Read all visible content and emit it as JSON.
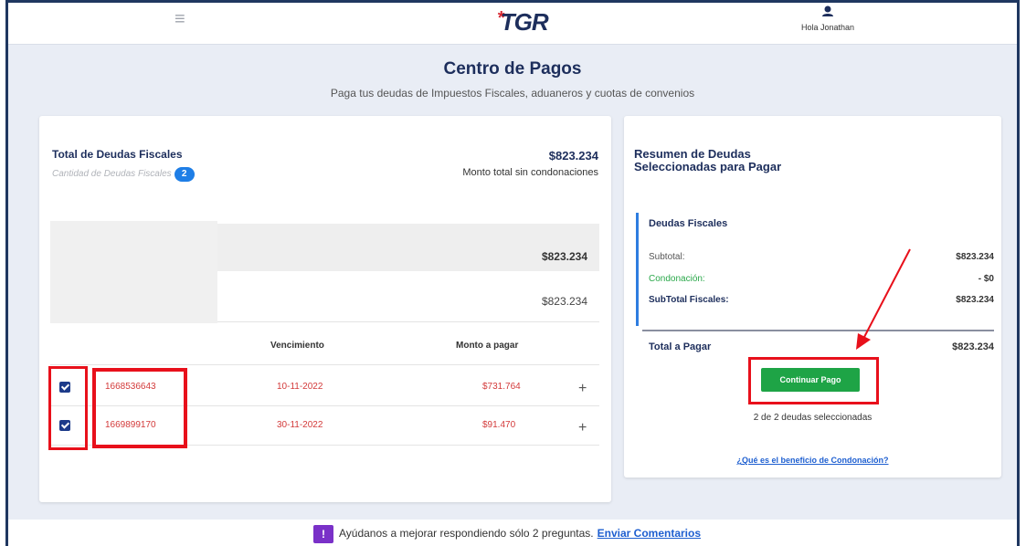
{
  "header": {
    "menu_icon": "hamburger-icon",
    "logo_star": "*",
    "logo_text": "TGR",
    "user_icon": "user-icon",
    "user_greeting": "Hola Jonathan"
  },
  "page": {
    "title": "Centro de Pagos",
    "subtitle": "Paga tus deudas de Impuestos Fiscales, aduaneros y cuotas de convenios"
  },
  "deudas": {
    "title": "Total de Deudas Fiscales",
    "count_label": "Cantidad de Deudas Fiscales",
    "count": "2",
    "total": "$823.234",
    "total_label": "Monto total sin condonaciones",
    "row_a_value": "$823.234",
    "row_b_value": "$823.234",
    "columns": {
      "vencimiento": "Vencimiento",
      "monto": "Monto a pagar"
    },
    "rows": [
      {
        "folio": "1668536643",
        "vencimiento": "10-11-2022",
        "monto": "$731.764",
        "expand": "+"
      },
      {
        "folio": "1669899170",
        "vencimiento": "30-11-2022",
        "monto": "$91.470",
        "expand": "+"
      }
    ]
  },
  "resumen": {
    "title_line1": "Resumen de Deudas",
    "title_line2": "Seleccionadas para Pagar",
    "section_title": "Deudas Fiscales",
    "subtotal_label": "Subtotal:",
    "subtotal_value": "$823.234",
    "condonacion_label": "Condonación:",
    "condonacion_value": "- $0",
    "subtotal_fiscales_label": "SubTotal Fiscales:",
    "subtotal_fiscales_value": "$823.234",
    "total_label": "Total a Pagar",
    "total_value": "$823.234",
    "continue_button": "Continuar Pago",
    "selected_info": "2 de 2 deudas seleccionadas",
    "condonacion_link": "¿Qué es el beneficio de Condonación?"
  },
  "footer": {
    "feedback_icon": "!",
    "feedback_text": "Ayúdanos a mejorar respondiendo sólo 2 preguntas.",
    "feedback_link": "Enviar Comentarios"
  },
  "colors": {
    "brand_navy": "#1d2e5c",
    "accent_blue": "#2e7de0",
    "button_green": "#1ea446",
    "debt_red": "#d33a3a",
    "highlight_red": "#e8101b",
    "condonacion_green": "#2aa84a"
  }
}
